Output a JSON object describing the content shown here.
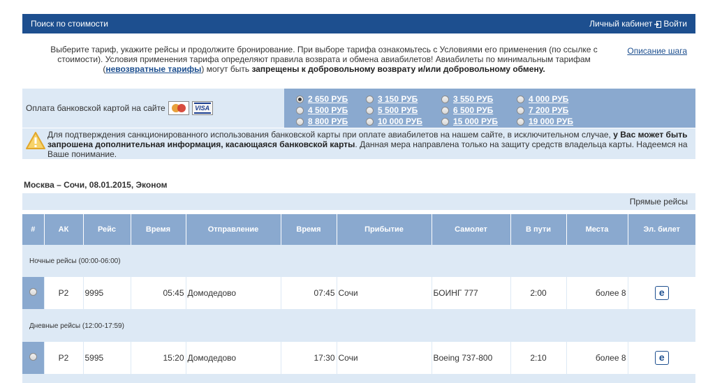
{
  "header": {
    "title": "Поиск по стоимости",
    "cabinet_label": "Личный кабинет",
    "login_label": "Войти"
  },
  "intro": {
    "text_part1": "Выберите тариф, укажите рейсы и продолжите бронирование. При выборе тарифа ознакомьтесь с Условиями его применения (по ссылке с стоимости). Условия применения тарифа определяют правила возврата и обмена авиабилетов! Авиабилеты по минимальным тарифам (",
    "link_text": "невозвратные тарифы",
    "text_part2": ") могут быть ",
    "bold_text": "запрещены к добровольному возврату и/или добровольному обмену.",
    "step_link": "Описание шага"
  },
  "payment": {
    "label": "Оплата банковской картой на сайте",
    "visa_label": "VISA"
  },
  "prices": [
    {
      "label": "2 650 РУБ",
      "checked": true
    },
    {
      "label": "3 150 РУБ",
      "checked": false
    },
    {
      "label": "3 550 РУБ",
      "checked": false
    },
    {
      "label": "4 000 РУБ",
      "checked": false
    },
    {
      "label": "4 500 РУБ",
      "checked": false
    },
    {
      "label": "5 500 РУБ",
      "checked": false
    },
    {
      "label": "6 500 РУБ",
      "checked": false
    },
    {
      "label": "7 200 РУБ",
      "checked": false
    },
    {
      "label": "8 800 РУБ",
      "checked": false
    },
    {
      "label": "10 000 РУБ",
      "checked": false
    },
    {
      "label": "15 000 РУБ",
      "checked": false
    },
    {
      "label": "19 000 РУБ",
      "checked": false
    }
  ],
  "warning": {
    "text_part1": "Для подтверждения санкционированного использования банковской карты при оплате авиабилетов на нашем сайте, в исключительном случае, ",
    "bold_text": "у Вас может быть запрошена дополнительная информация, касающаяся банковской карты",
    "text_part2": ". Данная мера направлена только на защиту средств владельца карты. Надеемся на Ваше понимание."
  },
  "route": "Москва – Сочи, 08.01.2015, Эконом",
  "direct_label": "Прямые рейсы",
  "table": {
    "headers": [
      "#",
      "АК",
      "Рейс",
      "Время",
      "Отправление",
      "Время",
      "Прибытие",
      "Самолет",
      "В пути",
      "Места",
      "Эл. билет"
    ],
    "groups": [
      {
        "label": "Ночные рейсы (00:00-06:00)",
        "rows": [
          {
            "ak": "P2",
            "flight": "9995",
            "dep_time": "05:45",
            "departure": "Домодедово",
            "arr_time": "07:45",
            "arrival": "Сочи",
            "aircraft": "БОИНГ 777",
            "duration": "2:00",
            "seats": "более 8",
            "eticket": "e"
          }
        ]
      },
      {
        "label": "Дневные рейсы (12:00-17:59)",
        "rows": [
          {
            "ak": "P2",
            "flight": "5995",
            "dep_time": "15:20",
            "departure": "Домодедово",
            "arr_time": "17:30",
            "arrival": "Сочи",
            "aircraft": "Boeing 737-800",
            "duration": "2:10",
            "seats": "более 8",
            "eticket": "e"
          }
        ]
      }
    ]
  },
  "colors": {
    "header_bg": "#1d4f8f",
    "accent_blue": "#8aa9cf",
    "light_blue": "#dde9f5"
  }
}
